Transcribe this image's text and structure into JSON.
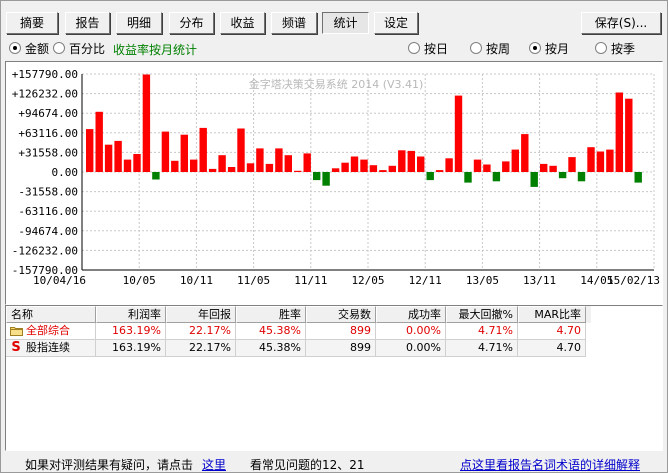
{
  "tabs": [
    "摘要",
    "报告",
    "明细",
    "分布",
    "收益",
    "频谱",
    "统计",
    "设定"
  ],
  "active_tab": "统计",
  "save_button": "保存(S)...",
  "mode_radios": [
    {
      "label": "金额",
      "checked": true
    },
    {
      "label": "百分比",
      "checked": false
    }
  ],
  "green_label": "收益率按月统计",
  "period_radios": [
    {
      "label": "按日",
      "checked": false
    },
    {
      "label": "按周",
      "checked": false
    },
    {
      "label": "按月",
      "checked": true
    },
    {
      "label": "按季",
      "checked": false
    }
  ],
  "colors": {
    "positive": "#ff0000",
    "negative": "#008000",
    "grid": "#c8c8c8",
    "watermark": "#b8b8b8"
  },
  "chart_data": {
    "type": "bar",
    "watermark": "金字塔决策交易系统 2014 (V3.41)",
    "ylim": [
      -157790,
      157790
    ],
    "y_ticks": [
      "+157790.00",
      "+126232.00",
      "+94674.00",
      "+63116.00",
      "+31558.00",
      "0.00",
      "-31558.00",
      "-63116.00",
      "-94674.00",
      "-126232.00",
      "-157790.00"
    ],
    "x_ticks": [
      "10/04/16",
      "10/05",
      "10/11",
      "11/05",
      "11/11",
      "12/05",
      "12/11",
      "13/05",
      "13/11",
      "14/05",
      "15/02/13"
    ],
    "values": [
      69000,
      97000,
      44000,
      50000,
      20000,
      29000,
      157000,
      -12000,
      65000,
      18000,
      60000,
      20000,
      71000,
      5000,
      27000,
      8000,
      70000,
      14000,
      38000,
      13000,
      38000,
      27000,
      2000,
      30000,
      -13000,
      -22000,
      6000,
      15000,
      25000,
      20000,
      11000,
      3000,
      10000,
      35000,
      34000,
      25000,
      -13000,
      3000,
      22000,
      123000,
      -17000,
      20000,
      12000,
      -15000,
      17000,
      36000,
      61000,
      -24000,
      13000,
      10000,
      -10000,
      24000,
      -15000,
      40000,
      33000,
      36000,
      128000,
      118000,
      -17000
    ]
  },
  "table": {
    "headers": [
      "名称",
      "利润率",
      "年回报",
      "胜率",
      "交易数",
      "成功率",
      "最大回撤%",
      "MAR比率"
    ],
    "rows": [
      {
        "name": "全部综合",
        "values": [
          "163.19%",
          "22.17%",
          "45.38%",
          "899",
          "0.00%",
          "4.71%",
          "4.70"
        ]
      },
      {
        "name": "股指连续",
        "values": [
          "163.19%",
          "22.17%",
          "45.38%",
          "899",
          "0.00%",
          "4.71%",
          "4.70"
        ]
      }
    ]
  },
  "footer": {
    "prefix": "如果对评测结果有疑问，请点击",
    "link1": "这里",
    "faq": "看常见问题的12、21",
    "link2": "点这里看报告名词术语的详细解释"
  }
}
